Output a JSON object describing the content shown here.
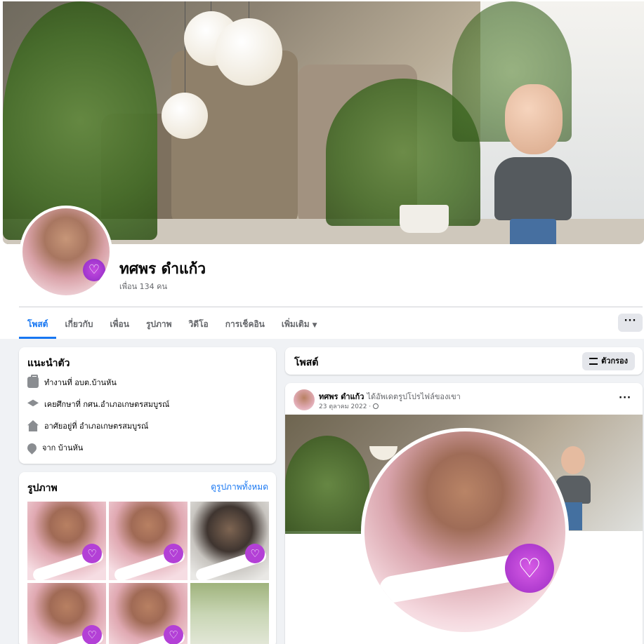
{
  "profile": {
    "name": "ทศพร ดำแก้ว",
    "friends_text": "เพื่อน 134 คน"
  },
  "tabs": [
    {
      "label": "โพสต์",
      "active": true
    },
    {
      "label": "เกี่ยวกับ",
      "active": false
    },
    {
      "label": "เพื่อน",
      "active": false
    },
    {
      "label": "รูปภาพ",
      "active": false
    },
    {
      "label": "วิดีโอ",
      "active": false
    },
    {
      "label": "การเช็คอิน",
      "active": false
    },
    {
      "label": "เพิ่มเติม",
      "active": false,
      "has_caret": true
    }
  ],
  "more_button_label": "···",
  "intro": {
    "title": "แนะนำตัว",
    "rows": [
      {
        "icon": "briefcase-icon",
        "text": "ทำงานที่ อบต.บ้านหัน"
      },
      {
        "icon": "graduation-cap-icon",
        "text": "เคยศึกษาที่ กศน.อำเภอเกษตรสมบูรณ์"
      },
      {
        "icon": "home-icon",
        "text": "อาศัยอยู่ที่ อำเภอเกษตรสมบูรณ์"
      },
      {
        "icon": "location-pin-icon",
        "text": "จาก บ้านหัน"
      }
    ]
  },
  "photos": {
    "title": "รูปภาพ",
    "see_all": "ดูรูปภาพทั้งหมด",
    "thumbnails": [
      "pink",
      "pink",
      "dark",
      "pink",
      "pink",
      "outdoor"
    ]
  },
  "posts": {
    "title": "โพสต์",
    "filter_label": "ตัวกรอง"
  },
  "post": {
    "author": "ทศพร ดำแก้ว",
    "action": "ได้อัพเดตรูปโปรไฟล์ของเขา",
    "date": "23 ตุลาคม 2022 ·",
    "menu_label": "···"
  },
  "colors": {
    "accent": "#1877f2",
    "background": "#f0f2f5",
    "button_gray": "#e4e6eb",
    "secondary_text": "#65676b"
  }
}
